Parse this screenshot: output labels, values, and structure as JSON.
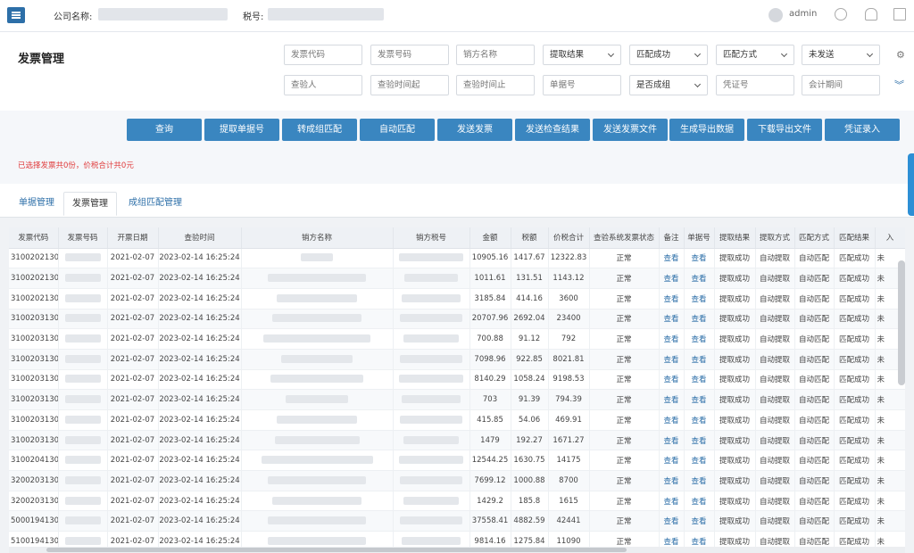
{
  "topbar": {
    "company_label": "公司名称:",
    "tax_label": "税号:",
    "user": "admin",
    "icons": [
      "menu-icon",
      "user-avatar-icon",
      "emoji-icon",
      "bell-icon",
      "home-icon"
    ]
  },
  "page_title": "发票管理",
  "filters": {
    "row1": [
      {
        "type": "input",
        "placeholder": "发票代码"
      },
      {
        "type": "input",
        "placeholder": "发票号码"
      },
      {
        "type": "input",
        "placeholder": "销方名称"
      },
      {
        "type": "select",
        "value": "提取结果"
      },
      {
        "type": "select",
        "value": "匹配成功"
      },
      {
        "type": "select",
        "value": "匹配方式"
      },
      {
        "type": "select",
        "value": "未发送"
      }
    ],
    "row2": [
      {
        "type": "input",
        "placeholder": "查验人"
      },
      {
        "type": "input",
        "placeholder": "查验时间起"
      },
      {
        "type": "input",
        "placeholder": "查验时间止"
      },
      {
        "type": "input",
        "placeholder": "单据号"
      },
      {
        "type": "select",
        "value": "是否成组"
      },
      {
        "type": "input",
        "placeholder": "凭证号"
      },
      {
        "type": "input",
        "placeholder": "会计期间"
      }
    ]
  },
  "actions": [
    "查询",
    "提取单据号",
    "转成组匹配",
    "自动匹配",
    "发送发票",
    "发送检查结果",
    "发送发票文件",
    "生成导出数据",
    "下载导出文件",
    "凭证录入"
  ],
  "selection_info": "已选择发票共0份，价税合计共0元",
  "tabs": [
    "单据管理",
    "发票管理",
    "成组匹配管理"
  ],
  "table": {
    "headers": [
      "发票代码",
      "发票号码",
      "开票日期",
      "查验时间",
      "销方名称",
      "销方税号",
      "金额",
      "税额",
      "价税合计",
      "查验系统发票状态",
      "备注",
      "单据号",
      "提取结果",
      "提取方式",
      "匹配方式",
      "匹配结果",
      "入"
    ],
    "rows": [
      {
        "code": "3100202130",
        "date": "2021-02-07",
        "check_time": "2023-02-14 16:25:24",
        "amount": "10905.16",
        "tax": "1417.67",
        "total": "12322.83"
      },
      {
        "code": "3100202130",
        "date": "2021-02-07",
        "check_time": "2023-02-14 16:25:24",
        "amount": "1011.61",
        "tax": "131.51",
        "total": "1143.12"
      },
      {
        "code": "3100202130",
        "date": "2021-02-07",
        "check_time": "2023-02-14 16:25:24",
        "amount": "3185.84",
        "tax": "414.16",
        "total": "3600"
      },
      {
        "code": "3100203130",
        "date": "2021-02-07",
        "check_time": "2023-02-14 16:25:24",
        "amount": "20707.96",
        "tax": "2692.04",
        "total": "23400"
      },
      {
        "code": "3100203130",
        "date": "2021-02-07",
        "check_time": "2023-02-14 16:25:24",
        "amount": "700.88",
        "tax": "91.12",
        "total": "792"
      },
      {
        "code": "3100203130",
        "date": "2021-02-07",
        "check_time": "2023-02-14 16:25:24",
        "amount": "7098.96",
        "tax": "922.85",
        "total": "8021.81"
      },
      {
        "code": "3100203130",
        "date": "2021-02-07",
        "check_time": "2023-02-14 16:25:24",
        "amount": "8140.29",
        "tax": "1058.24",
        "total": "9198.53"
      },
      {
        "code": "3100203130",
        "date": "2021-02-07",
        "check_time": "2023-02-14 16:25:24",
        "amount": "703",
        "tax": "91.39",
        "total": "794.39"
      },
      {
        "code": "3100203130",
        "date": "2021-02-07",
        "check_time": "2023-02-14 16:25:24",
        "amount": "415.85",
        "tax": "54.06",
        "total": "469.91"
      },
      {
        "code": "3100203130",
        "date": "2021-02-07",
        "check_time": "2023-02-14 16:25:24",
        "amount": "1479",
        "tax": "192.27",
        "total": "1671.27"
      },
      {
        "code": "3100204130",
        "date": "2021-02-07",
        "check_time": "2023-02-14 16:25:24",
        "amount": "12544.25",
        "tax": "1630.75",
        "total": "14175"
      },
      {
        "code": "3200203130",
        "date": "2021-02-07",
        "check_time": "2023-02-14 16:25:24",
        "amount": "7699.12",
        "tax": "1000.88",
        "total": "8700"
      },
      {
        "code": "3200203130",
        "date": "2021-02-07",
        "check_time": "2023-02-14 16:25:24",
        "amount": "1429.2",
        "tax": "185.8",
        "total": "1615"
      },
      {
        "code": "5000194130",
        "date": "2021-02-07",
        "check_time": "2023-02-14 16:25:24",
        "amount": "37558.41",
        "tax": "4882.59",
        "total": "42441"
      },
      {
        "code": "5100194130",
        "date": "2021-02-07",
        "check_time": "2023-02-14 16:25:24",
        "amount": "9814.16",
        "tax": "1275.84",
        "total": "11090"
      }
    ],
    "row_constants": {
      "status": "正常",
      "remark": "查看",
      "doc_no": "查看",
      "extract_result": "提取成功",
      "extract_method": "自动提取",
      "match_method": "自动匹配",
      "match_result": "匹配成功",
      "last": "未"
    }
  }
}
